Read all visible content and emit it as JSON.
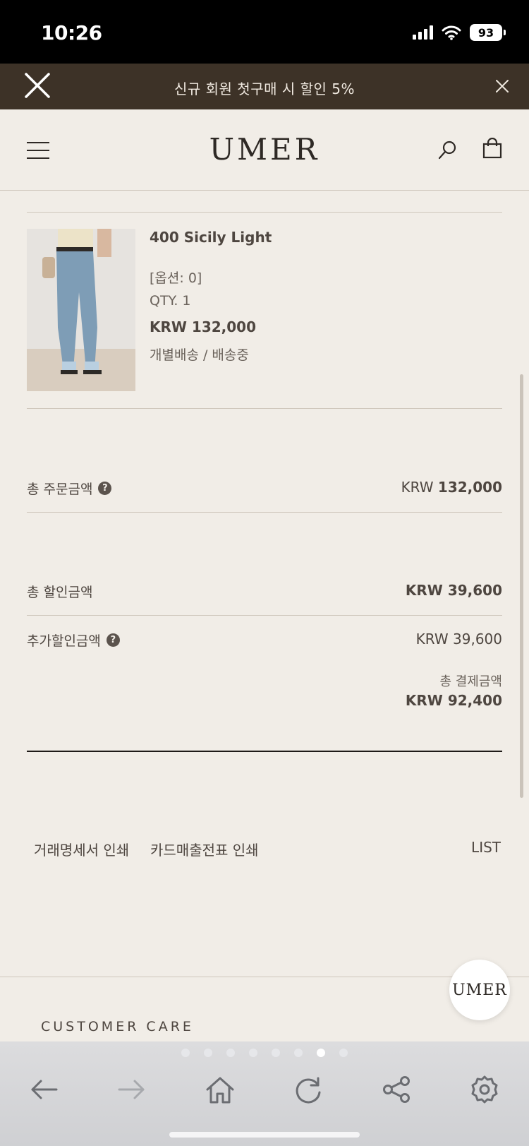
{
  "status_bar": {
    "time": "10:26",
    "battery": "93"
  },
  "promo": {
    "text": "신규 회원 첫구매 시 할인 5%"
  },
  "header": {
    "logo": "UMER"
  },
  "order_item": {
    "name": "400 Sicily Light",
    "option": "[옵션: 0]",
    "qty": "QTY. 1",
    "price": "KRW 132,000",
    "shipping": "개별배송 / 배송중"
  },
  "summary": {
    "total_order_label": "총 주문금액",
    "total_order_currency": "KRW",
    "total_order_amount": "132,000",
    "total_discount_label": "총 할인금액",
    "total_discount_value": "KRW 39,600",
    "extra_discount_label": "추가할인금액",
    "extra_discount_value": "KRW 39,600",
    "total_payment_label": "총 결제금액",
    "total_payment_value": "KRW 92,400"
  },
  "actions": {
    "receipt_print": "거래명세서 인쇄",
    "card_slip_print": "카드매출전표 인쇄",
    "list": "LIST"
  },
  "footer": {
    "customer_care": "CUSTOMER CARE",
    "fab_label": "UMER"
  },
  "toolbar": {
    "buttons": [
      "back-icon",
      "forward-icon",
      "home-icon",
      "refresh-icon",
      "share-icon",
      "settings-icon"
    ],
    "page_dots": 8,
    "active_dot": 6
  },
  "colors": {
    "page_bg": "#f1ede7",
    "promo_bg": "#3d3227",
    "text": "#4e4640",
    "toolbar_bg": "#d5d6d9"
  }
}
